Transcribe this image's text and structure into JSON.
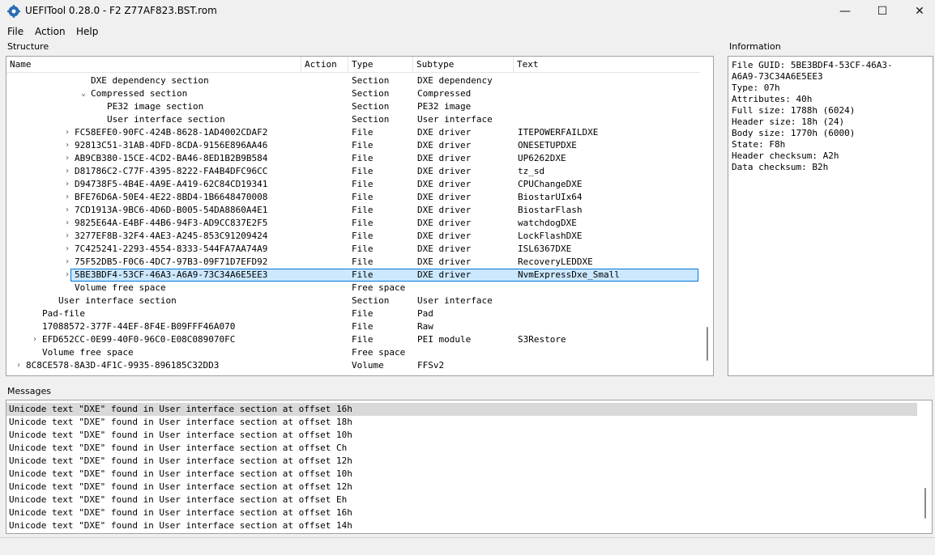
{
  "window": {
    "title": "UEFITool 0.28.0 - F2 Z77AF823.BST.rom",
    "controls": {
      "minimize": "—",
      "maximize": "☐",
      "close": "✕"
    }
  },
  "menu": [
    "File",
    "Action",
    "Help"
  ],
  "structure": {
    "label": "Structure",
    "columns": [
      "Name",
      "Action",
      "Type",
      "Subtype",
      "Text"
    ],
    "rows": [
      {
        "name": "DXE dependency section",
        "indent": 3,
        "chevron": "",
        "type": "Section",
        "subtype": "DXE dependency",
        "text": ""
      },
      {
        "name": "Compressed section",
        "indent": 3,
        "chevron": "⌄",
        "type": "Section",
        "subtype": "Compressed",
        "text": ""
      },
      {
        "name": "PE32 image section",
        "indent": 4,
        "chevron": "",
        "type": "Section",
        "subtype": "PE32 image",
        "text": ""
      },
      {
        "name": "User interface section",
        "indent": 4,
        "chevron": "",
        "type": "Section",
        "subtype": "User interface",
        "text": ""
      },
      {
        "name": "FC58EFE0-90FC-424B-8628-1AD4002CDAF2",
        "indent": 2,
        "chevron": "›",
        "type": "File",
        "subtype": "DXE driver",
        "text": "ITEPOWERFAILDXE"
      },
      {
        "name": "92813C51-31AB-4DFD-8CDA-9156E896AA46",
        "indent": 2,
        "chevron": "›",
        "type": "File",
        "subtype": "DXE driver",
        "text": "ONESETUPDXE"
      },
      {
        "name": "AB9CB380-15CE-4CD2-BA46-8ED1B2B9B584",
        "indent": 2,
        "chevron": "›",
        "type": "File",
        "subtype": "DXE driver",
        "text": "UP6262DXE"
      },
      {
        "name": "D81786C2-C77F-4395-8222-FA4B4DFC96CC",
        "indent": 2,
        "chevron": "›",
        "type": "File",
        "subtype": "DXE driver",
        "text": "tz_sd"
      },
      {
        "name": "D94738F5-4B4E-4A9E-A419-62C84CD19341",
        "indent": 2,
        "chevron": "›",
        "type": "File",
        "subtype": "DXE driver",
        "text": "CPUChangeDXE"
      },
      {
        "name": "BFE76D6A-50E4-4E22-8BD4-1B6648470008",
        "indent": 2,
        "chevron": "›",
        "type": "File",
        "subtype": "DXE driver",
        "text": "BiostarUIx64"
      },
      {
        "name": "7CD1913A-9BC6-4D6D-B005-54DA8860A4E1",
        "indent": 2,
        "chevron": "›",
        "type": "File",
        "subtype": "DXE driver",
        "text": "BiostarFlash"
      },
      {
        "name": "9825E64A-E4BF-44B6-94F3-AD9CC837E2F5",
        "indent": 2,
        "chevron": "›",
        "type": "File",
        "subtype": "DXE driver",
        "text": "watchdogDXE"
      },
      {
        "name": "3277EF8B-32F4-4AE3-A245-853C91209424",
        "indent": 2,
        "chevron": "›",
        "type": "File",
        "subtype": "DXE driver",
        "text": "LockFlashDXE"
      },
      {
        "name": "7C425241-2293-4554-8333-544FA7AA74A9",
        "indent": 2,
        "chevron": "›",
        "type": "File",
        "subtype": "DXE driver",
        "text": "ISL6367DXE"
      },
      {
        "name": "75F52DB5-F0C6-4DC7-97B3-09F71D7EFD92",
        "indent": 2,
        "chevron": "›",
        "type": "File",
        "subtype": "DXE driver",
        "text": "RecoveryLEDDXE"
      },
      {
        "name": "5BE3BDF4-53CF-46A3-A6A9-73C34A6E5EE3",
        "indent": 2,
        "chevron": "›",
        "type": "File",
        "subtype": "DXE driver",
        "text": "NvmExpressDxe_Small",
        "selected": true
      },
      {
        "name": "Volume free space",
        "indent": 2,
        "chevron": "",
        "type": "Free space",
        "subtype": "",
        "text": ""
      },
      {
        "name": "User interface section",
        "indent": 1,
        "chevron": "",
        "type": "Section",
        "subtype": "User interface",
        "text": ""
      },
      {
        "name": "Pad-file",
        "indent": 0,
        "chevron": "",
        "type": "File",
        "subtype": "Pad",
        "text": ""
      },
      {
        "name": "17088572-377F-44EF-8F4E-B09FFF46A070",
        "indent": 0,
        "chevron": "",
        "type": "File",
        "subtype": "Raw",
        "text": ""
      },
      {
        "name": "EFD652CC-0E99-40F0-96C0-E08C089070FC",
        "indent": 0,
        "chevron": "›",
        "type": "File",
        "subtype": "PEI module",
        "text": "S3Restore"
      },
      {
        "name": "Volume free space",
        "indent": 0,
        "chevron": "",
        "type": "Free space",
        "subtype": "",
        "text": ""
      },
      {
        "name": "8C8CE578-8A3D-4F1C-9935-896185C32DD3",
        "indent": -1,
        "chevron": "›",
        "type": "Volume",
        "subtype": "FFSv2",
        "text": ""
      }
    ]
  },
  "information": {
    "label": "Information",
    "lines": [
      "File GUID: 5BE3BDF4-53CF-46A3-",
      "A6A9-73C34A6E5EE3",
      "Type: 07h",
      "Attributes: 40h",
      "Full size: 1788h (6024)",
      "Header size: 18h (24)",
      "Body size: 1770h (6000)",
      "State: F8h",
      "Header checksum: A2h",
      "Data checksum: B2h"
    ]
  },
  "messages": {
    "label": "Messages",
    "lines": [
      "Unicode text \"DXE\" found in User interface section at offset 16h",
      "Unicode text \"DXE\" found in User interface section at offset 18h",
      "Unicode text \"DXE\" found in User interface section at offset 10h",
      "Unicode text \"DXE\" found in User interface section at offset Ch",
      "Unicode text \"DXE\" found in User interface section at offset 12h",
      "Unicode text \"DXE\" found in User interface section at offset 10h",
      "Unicode text \"DXE\" found in User interface section at offset 12h",
      "Unicode text \"DXE\" found in User interface section at offset Eh",
      "Unicode text \"DXE\" found in User interface section at offset 16h",
      "Unicode text \"DXE\" found in User interface section at offset 14h"
    ]
  },
  "colors": {
    "selection_bg": "#cce8ff",
    "selection_border": "#0078d7",
    "app_icon": "#2a6db5"
  },
  "icons": {
    "app": "gear-icon"
  }
}
